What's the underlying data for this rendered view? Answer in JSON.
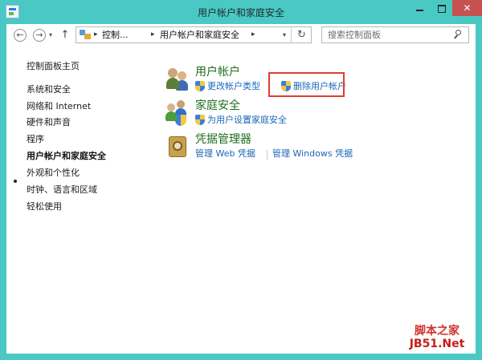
{
  "window": {
    "title": "用户帐户和家庭安全",
    "close_glyph": "✕",
    "colors": {
      "frame": "#49c8c4",
      "close": "#c75050",
      "link": "#1a67b8",
      "category": "#1e6d1e",
      "highlight": "#e03c31"
    }
  },
  "navbar": {
    "back_glyph": "←",
    "forward_glyph": "→",
    "history_glyph": "▾",
    "up_glyph": "↑",
    "breadcrumbs": [
      "控制...",
      "用户帐户和家庭安全"
    ],
    "crumb_sep": "▸",
    "dropdown_glyph": "▾",
    "refresh_glyph": "↻",
    "search_placeholder": "搜索控制面板"
  },
  "left_nav": {
    "home": "控制面板主页",
    "items": [
      "系统和安全",
      "网络和 Internet",
      "硬件和声音",
      "程序",
      "用户帐户和家庭安全",
      "外观和个性化",
      "时钟、语言和区域",
      "轻松使用"
    ],
    "current": "用户帐户和家庭安全"
  },
  "main": {
    "categories": [
      {
        "title": "用户帐户",
        "icon": "users-icon",
        "links": [
          "更改帐户类型",
          "删除用户帐户"
        ]
      },
      {
        "title": "家庭安全",
        "icon": "family-safety-icon",
        "links": [
          "为用户设置家庭安全"
        ]
      },
      {
        "title": "凭据管理器",
        "icon": "credential-manager-icon",
        "links": [
          "管理 Web 凭据",
          "管理 Windows 凭据"
        ]
      }
    ]
  },
  "watermark": {
    "line1": "脚本之家",
    "line2": "JB51.Net"
  }
}
